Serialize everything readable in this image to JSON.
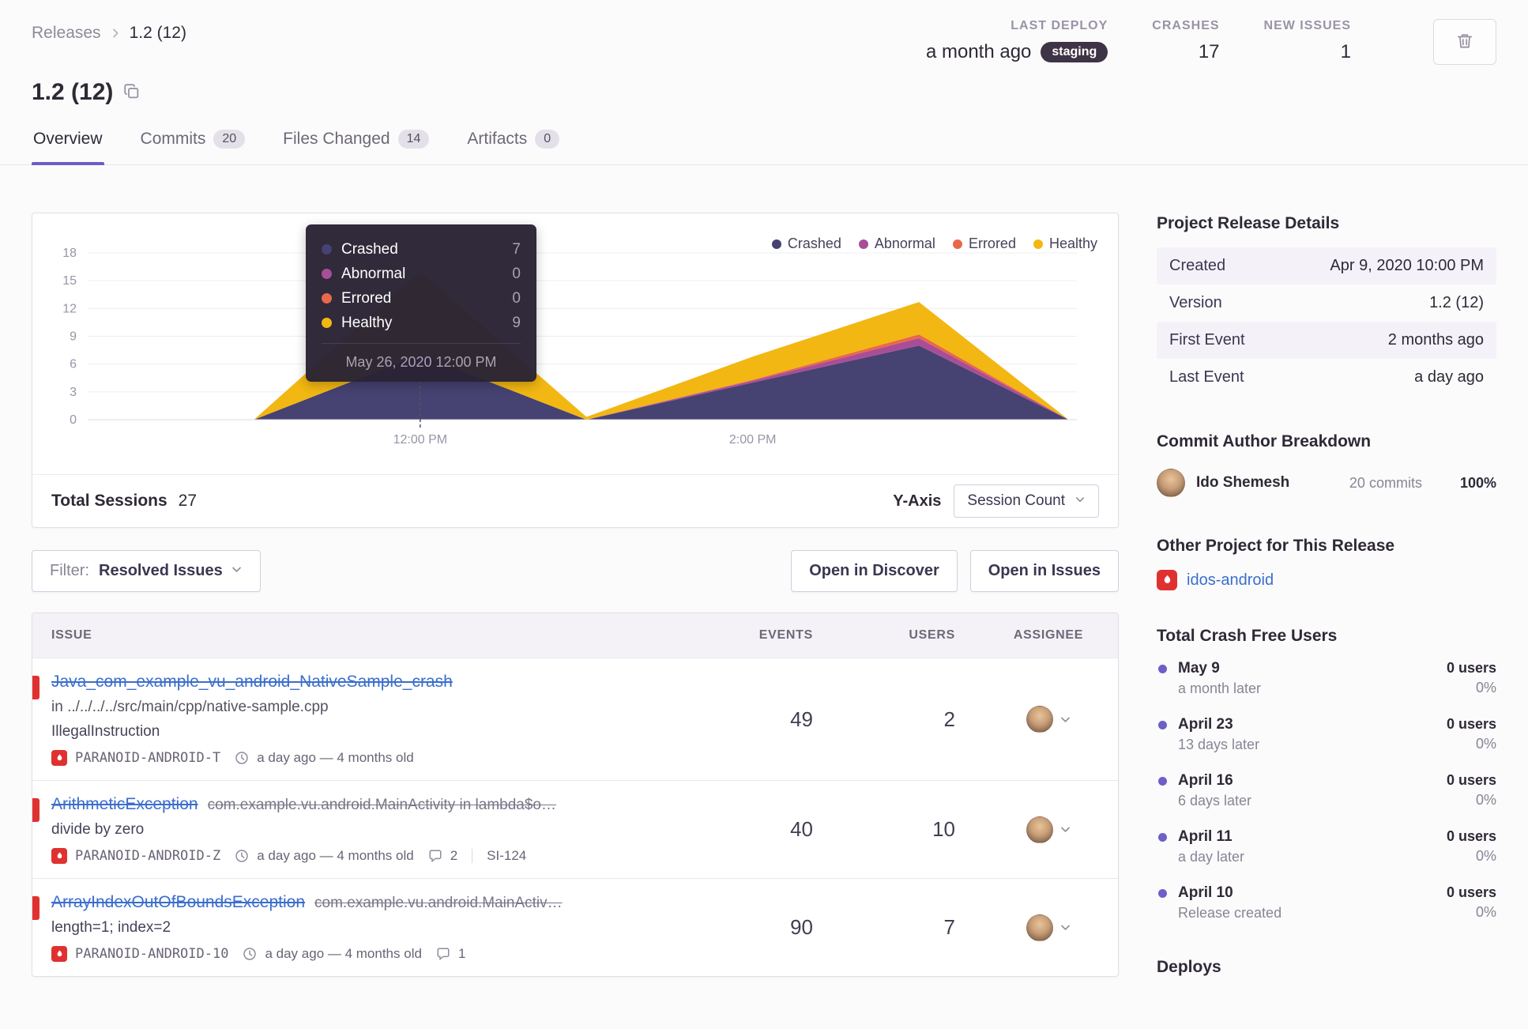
{
  "colors": {
    "accent": "#6c5fc7",
    "link_blue": "#3b6ecc",
    "error_red": "#e03131"
  },
  "breadcrumb": {
    "parent": "Releases",
    "current": "1.2 (12)"
  },
  "header": {
    "title": "1.2 (12)",
    "stats": {
      "last_deploy": {
        "label": "LAST DEPLOY",
        "value": "a month ago",
        "env": "staging"
      },
      "crashes": {
        "label": "CRASHES",
        "value": "17"
      },
      "new_issues": {
        "label": "NEW ISSUES",
        "value": "1"
      }
    }
  },
  "tabs": [
    {
      "label": "Overview"
    },
    {
      "label": "Commits",
      "badge": "20"
    },
    {
      "label": "Files Changed",
      "badge": "14"
    },
    {
      "label": "Artifacts",
      "badge": "0"
    }
  ],
  "chart_card": {
    "tooltip": {
      "rows": [
        {
          "label": "Crashed",
          "value": "7",
          "color": "#464272"
        },
        {
          "label": "Abnormal",
          "value": "0",
          "color": "#a84e96"
        },
        {
          "label": "Errored",
          "value": "0",
          "color": "#e8684a"
        },
        {
          "label": "Healthy",
          "value": "9",
          "color": "#f2b712"
        }
      ],
      "date": "May 26, 2020 12:00 PM"
    },
    "legend": [
      {
        "label": "Crashed",
        "color": "#464272"
      },
      {
        "label": "Abnormal",
        "color": "#a84e96"
      },
      {
        "label": "Errored",
        "color": "#e8684a"
      },
      {
        "label": "Healthy",
        "color": "#f2b712"
      }
    ],
    "footer": {
      "total_sessions_label": "Total Sessions",
      "total_sessions_value": "27",
      "yaxis_label": "Y-Axis",
      "yaxis_value": "Session Count"
    }
  },
  "chart_data": {
    "type": "area",
    "stacked": true,
    "title": "Release sessions by status",
    "x_unit": "hour_of_day_may_26_2020",
    "x": [
      10,
      11,
      12,
      13,
      14,
      15,
      15.9
    ],
    "series": [
      {
        "name": "Crashed",
        "color": "#464272",
        "values": [
          0,
          0,
          7,
          0,
          4,
          8,
          0
        ]
      },
      {
        "name": "Abnormal",
        "color": "#a84e96",
        "values": [
          0,
          0,
          0,
          0,
          0.2,
          0.8,
          0
        ]
      },
      {
        "name": "Errored",
        "color": "#e8684a",
        "values": [
          0,
          0,
          0,
          0,
          0.1,
          0.4,
          0
        ]
      },
      {
        "name": "Healthy",
        "color": "#f2b712",
        "values": [
          0,
          0,
          9,
          0.3,
          2.5,
          3.5,
          0
        ]
      }
    ],
    "y_ticks": [
      0,
      3,
      6,
      9,
      12,
      15,
      18
    ],
    "y_max": 18,
    "x_ticks": [
      {
        "value": 12,
        "label": "12:00 PM"
      },
      {
        "value": 14,
        "label": "2:00 PM"
      }
    ],
    "x_range": [
      10,
      15.95
    ],
    "cursor_x": 12,
    "grid": true,
    "legend_position": "top-right",
    "ylabel": "Session Count"
  },
  "filter_bar": {
    "filter_label": "Filter:",
    "filter_value": "Resolved Issues",
    "open_discover": "Open in Discover",
    "open_issues": "Open in Issues"
  },
  "issues": {
    "columns": {
      "issue": "ISSUE",
      "events": "EVENTS",
      "users": "USERS",
      "assignee": "ASSIGNEE"
    },
    "rows": [
      {
        "title": "Java_com_example_vu_android_NativeSample_crash",
        "location": "in ../../../../src/main/cpp/native-sample.cpp",
        "message": "IllegalInstruction",
        "project": "PARANOID-ANDROID-T",
        "age": "a day ago — 4 months old",
        "events": "49",
        "users": "2"
      },
      {
        "title": "ArithmeticException",
        "culprit": "com.example.vu.android.MainActivity in lambda$o…",
        "message": "divide by zero",
        "project": "PARANOID-ANDROID-Z",
        "age": "a day ago — 4 months old",
        "comments": "2",
        "annotation": "SI-124",
        "events": "40",
        "users": "10"
      },
      {
        "title": "ArrayIndexOutOfBoundsException",
        "culprit": "com.example.vu.android.MainActiv…",
        "message": "length=1; index=2",
        "project": "PARANOID-ANDROID-10",
        "age": "a day ago — 4 months old",
        "comments": "1",
        "events": "90",
        "users": "7"
      }
    ]
  },
  "sidebar": {
    "release_details": {
      "heading": "Project Release Details",
      "rows": [
        {
          "label": "Created",
          "value": "Apr 9, 2020 10:00 PM"
        },
        {
          "label": "Version",
          "value": "1.2 (12)"
        },
        {
          "label": "First Event",
          "value": "2 months ago"
        },
        {
          "label": "Last Event",
          "value": "a day ago"
        }
      ]
    },
    "commit_authors": {
      "heading": "Commit Author Breakdown",
      "author": {
        "name": "Ido Shemesh",
        "commits": "20 commits",
        "percent": "100%"
      }
    },
    "other_project": {
      "heading": "Other Project for This Release",
      "project": "idos-android"
    },
    "crash_free": {
      "heading": "Total Crash Free Users",
      "items": [
        {
          "date": "May 9",
          "sub": "a month later",
          "users": "0 users",
          "percent": "0%"
        },
        {
          "date": "April 23",
          "sub": "13 days later",
          "users": "0 users",
          "percent": "0%"
        },
        {
          "date": "April 16",
          "sub": "6 days later",
          "users": "0 users",
          "percent": "0%"
        },
        {
          "date": "April 11",
          "sub": "a day later",
          "users": "0 users",
          "percent": "0%"
        },
        {
          "date": "April 10",
          "sub": "Release created",
          "users": "0 users",
          "percent": "0%"
        }
      ]
    },
    "deploys_heading": "Deploys"
  }
}
